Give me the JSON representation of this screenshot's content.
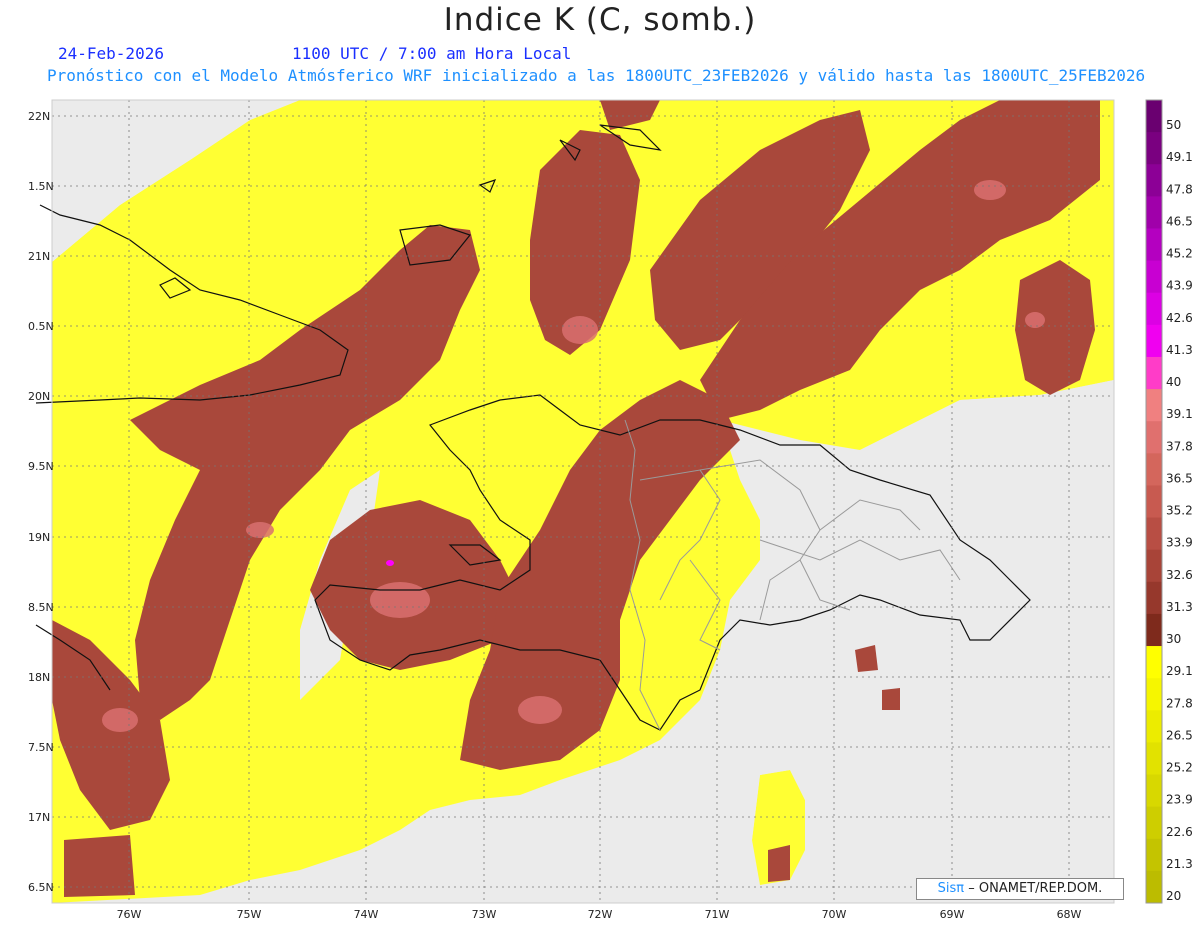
{
  "header": {
    "title": "Indice K (C, somb.)",
    "date": "24-Feb-2026",
    "time": "1100 UTC / 7:00 am Hora Local",
    "forecast_line": "Pronóstico con el Modelo Atmósferico WRF inicializado a las 1800UTC_23FEB2026 y válido hasta las  1800UTC_25FEB2026"
  },
  "axes": {
    "lat_labels": [
      "22N",
      "1.5N",
      "21N",
      "0.5N",
      "20N",
      "9.5N",
      "19N",
      "8.5N",
      "18N",
      "7.5N",
      "17N",
      "6.5N"
    ],
    "lon_labels": [
      "76W",
      "75W",
      "74W",
      "73W",
      "72W",
      "71W",
      "70W",
      "69W",
      "68W"
    ]
  },
  "colorbar": {
    "labels": [
      "50",
      "49.1",
      "47.8",
      "46.5",
      "45.2",
      "43.9",
      "42.6",
      "41.3",
      "40",
      "39.1",
      "37.8",
      "36.5",
      "35.2",
      "33.9",
      "32.6",
      "31.3",
      "30",
      "29.1",
      "27.8",
      "26.5",
      "25.2",
      "23.9",
      "22.6",
      "21.3",
      "20"
    ],
    "colors": [
      "#6a0070",
      "#7a0080",
      "#8c0096",
      "#a000aa",
      "#b400c0",
      "#c800d2",
      "#dc00e4",
      "#f000f0",
      "#ff3cc8",
      "#f08080",
      "#e0706e",
      "#d4665c",
      "#c85a50",
      "#b84e44",
      "#a84438",
      "#96382c",
      "#7e2a1c",
      "#ffff00",
      "#f6f600",
      "#ecec00",
      "#e2e200",
      "#d8d800",
      "#cece00",
      "#c4c400",
      "#bcbc00"
    ]
  },
  "credit": {
    "brand": "Sisπ",
    "org": "– ONAMET/REP.DOM."
  },
  "palette": {
    "background": "#ebebeb",
    "yellow": "#ffff33",
    "brown": "#a9483b",
    "pink": "#d97070",
    "coast": "#111111",
    "border": "#9a9a9a"
  }
}
